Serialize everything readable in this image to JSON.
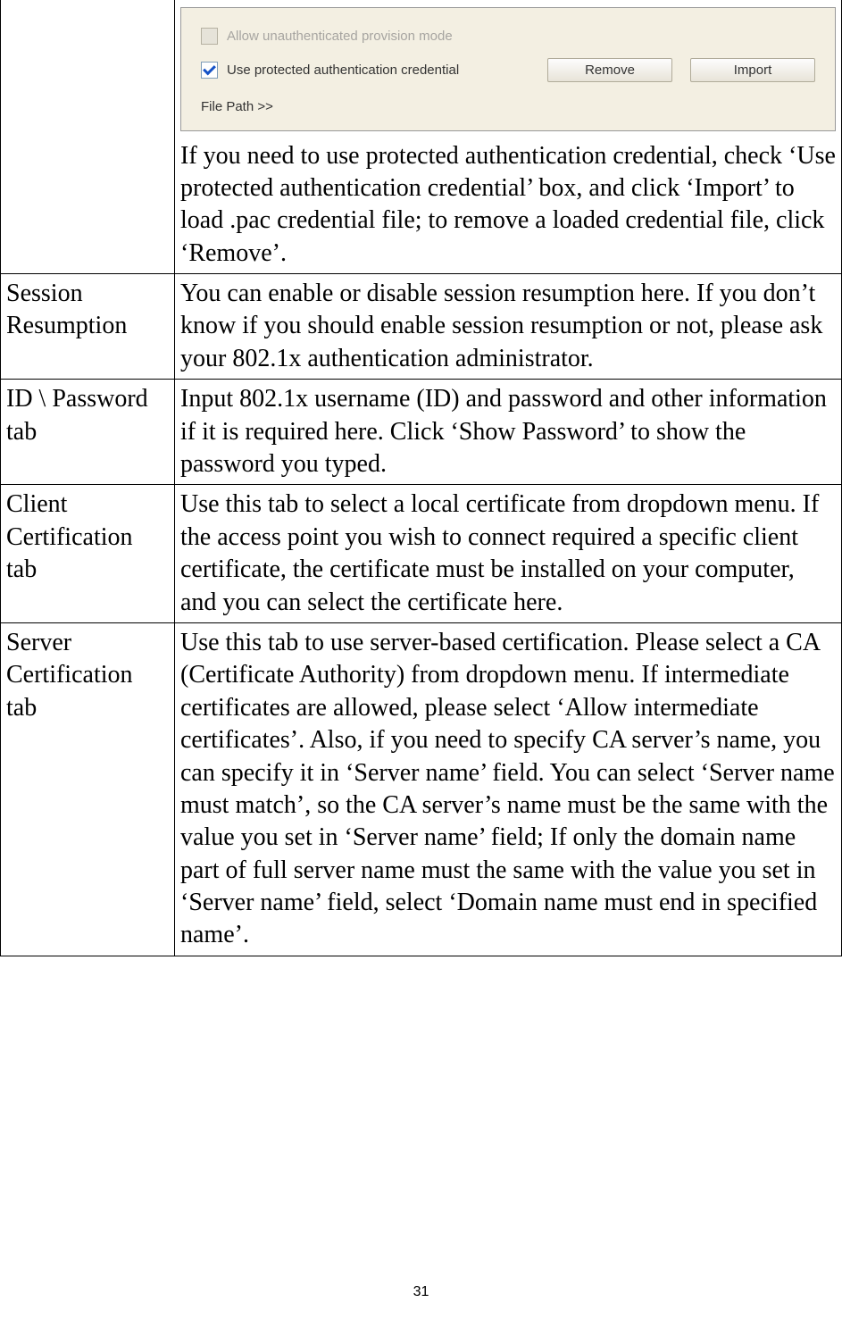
{
  "page_number": "31",
  "rows": [
    {
      "left": "",
      "panel": {
        "checkbox1_label": "Allow unauthenticated provision mode",
        "checkbox2_label": "Use protected authentication credential",
        "remove_label": "Remove",
        "import_label": "Import",
        "file_path_label": "File Path >>"
      },
      "right_paragraph": "If you need to use protected authentication credential, check ‘Use protected authentication credential’ box, and click ‘Import’ to load .pac credential file; to remove a loaded credential file, click ‘Remove’."
    },
    {
      "left": "Session Resumption",
      "right": "You can enable or disable session resumption here. If you don’t know if you should enable session resumption or not, please ask your 802.1x authentication administrator."
    },
    {
      "left": "ID \\ Password tab",
      "right": "Input 802.1x username (ID) and password and other information if it is required here. Click ‘Show Password’ to show the password you typed."
    },
    {
      "left": "Client Certification tab",
      "right": "Use this tab to select a local certificate from dropdown menu. If the access point you wish to connect required a specific client certificate, the certificate must be installed on your computer, and you can select the certificate here."
    },
    {
      "left": "Server Certification tab",
      "right": "Use this tab to use server-based certification. Please select a CA (Certificate Authority) from dropdown menu. If intermediate certificates are allowed, please select ‘Allow intermediate certificates’. Also, if you need to specify CA server’s name, you can specify it in ‘Server name’ field. You can select ‘Server name must match’, so the CA server’s name must be the same with the value you set in ‘Server name’ field; If only the domain name part of full server name must the same with the value you set in ‘Server name’ field, select ‘Domain name must end in specified name’."
    }
  ]
}
